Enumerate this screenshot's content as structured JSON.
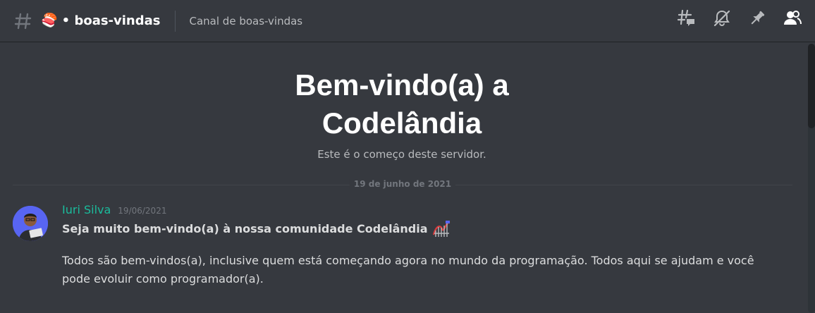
{
  "header": {
    "channel_emoji": "🍣",
    "channel_name": "• boas-vindas",
    "channel_topic": "Canal de boas-vindas",
    "toolbar_icons": [
      "threads-icon",
      "notifications-muted-icon",
      "pin-icon",
      "member-list-icon"
    ]
  },
  "welcome": {
    "title": "Bem-vindo(a) a Codelândia",
    "subtitle": "Este é o começo deste servidor."
  },
  "date_separator": "19 de junho de 2021",
  "message": {
    "author": "Iuri Silva",
    "author_color": "#1abc9c",
    "timestamp": "19/06/2021",
    "headline": "Seja muito bem-vindo(a) à nossa comunidade Codelândia",
    "headline_emoji": "roller-coaster-icon",
    "body": "Todos são bem-vindos(a), inclusive quem está começando agora no mundo da programação. Todos aqui se ajudam e você pode evoluir como programador(a)."
  },
  "colors": {
    "background": "#36393f",
    "accent": "#5865f2"
  }
}
